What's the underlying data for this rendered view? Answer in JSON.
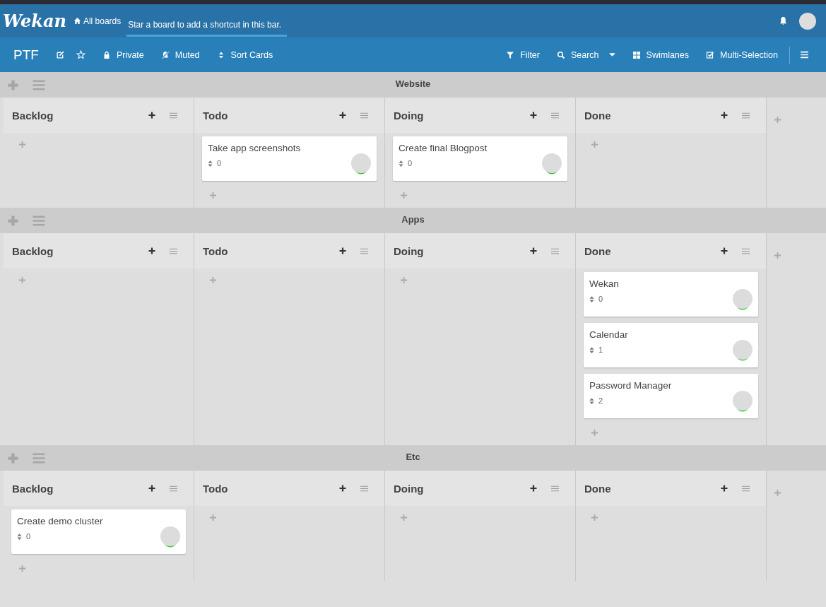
{
  "header": {
    "logo": "Wekan",
    "all_boards": "All boards",
    "shortcut_hint": "Star a board to add a shortcut in this bar."
  },
  "board_bar": {
    "title": "PTF",
    "visibility": "Private",
    "watch": "Muted",
    "sort": "Sort Cards",
    "filter": "Filter",
    "search": "Search",
    "view": "Swimlanes",
    "multi_selection": "Multi-Selection"
  },
  "swimlanes": [
    {
      "title": "Website",
      "lists": [
        {
          "title": "Backlog"
        },
        {
          "title": "Todo",
          "cards": [
            {
              "title": "Take app screenshots",
              "count": "0"
            }
          ]
        },
        {
          "title": "Doing",
          "cards": [
            {
              "title": "Create final Blogpost",
              "count": "0"
            }
          ]
        },
        {
          "title": "Done"
        }
      ]
    },
    {
      "title": "Apps",
      "lists": [
        {
          "title": "Backlog"
        },
        {
          "title": "Todo"
        },
        {
          "title": "Doing"
        },
        {
          "title": "Done",
          "cards": [
            {
              "title": "Wekan",
              "count": "0"
            },
            {
              "title": "Calendar",
              "count": "1"
            },
            {
              "title": "Password Manager",
              "count": "2"
            }
          ]
        }
      ]
    },
    {
      "title": "Etc",
      "lists": [
        {
          "title": "Backlog",
          "cards": [
            {
              "title": "Create demo cluster",
              "count": "0"
            }
          ]
        },
        {
          "title": "Todo"
        },
        {
          "title": "Doing"
        },
        {
          "title": "Done"
        }
      ]
    }
  ]
}
